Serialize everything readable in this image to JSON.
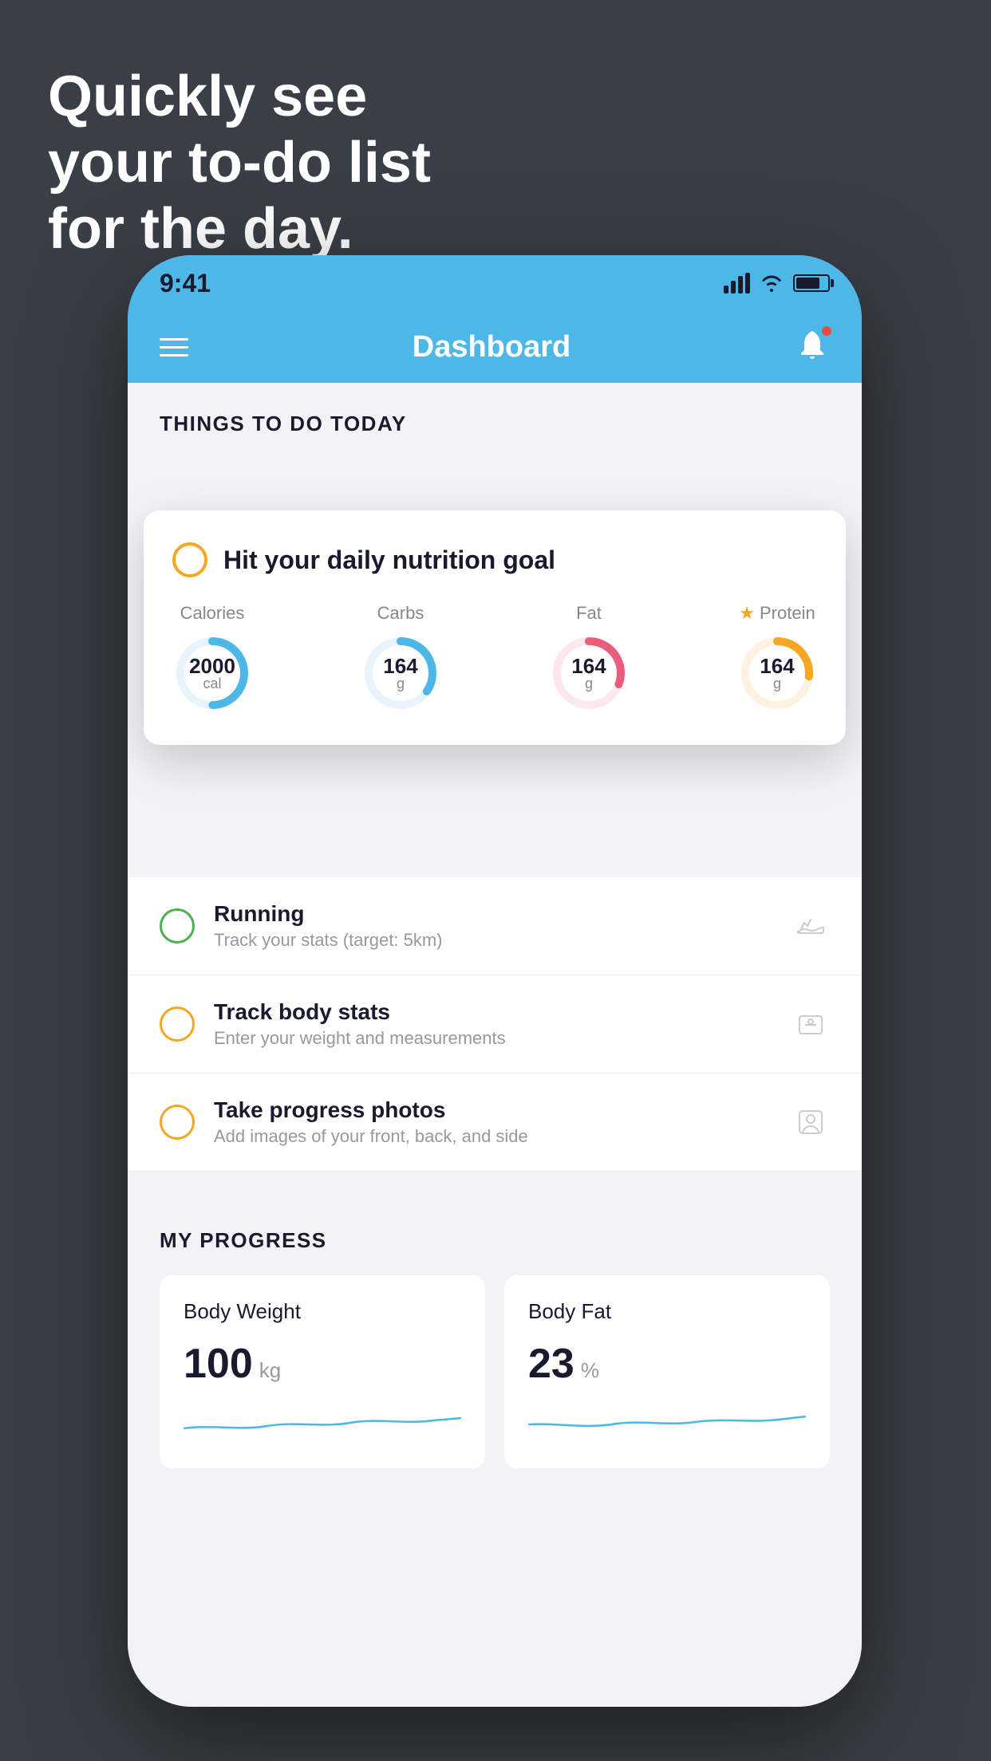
{
  "background": {
    "color": "#3a3f47"
  },
  "headline": {
    "line1": "Quickly see",
    "line2": "your to-do list",
    "line3": "for the day."
  },
  "phone": {
    "status_bar": {
      "time": "9:41"
    },
    "nav_bar": {
      "title": "Dashboard"
    },
    "section_header": {
      "title": "THINGS TO DO TODAY"
    },
    "nutrition_card": {
      "title": "Hit your daily nutrition goal",
      "rings": [
        {
          "label": "Calories",
          "value": "2000",
          "unit": "cal",
          "color": "#4db8e8",
          "star": false
        },
        {
          "label": "Carbs",
          "value": "164",
          "unit": "g",
          "color": "#4db8e8",
          "star": false
        },
        {
          "label": "Fat",
          "value": "164",
          "unit": "g",
          "color": "#e85d7a",
          "star": false
        },
        {
          "label": "Protein",
          "value": "164",
          "unit": "g",
          "color": "#f5a623",
          "star": true
        }
      ]
    },
    "todo_items": [
      {
        "title": "Running",
        "subtitle": "Track your stats (target: 5km)",
        "icon": "shoe",
        "circle_color": "green"
      },
      {
        "title": "Track body stats",
        "subtitle": "Enter your weight and measurements",
        "icon": "scale",
        "circle_color": "yellow"
      },
      {
        "title": "Take progress photos",
        "subtitle": "Add images of your front, back, and side",
        "icon": "person",
        "circle_color": "yellow"
      }
    ],
    "progress": {
      "title": "MY PROGRESS",
      "cards": [
        {
          "title": "Body Weight",
          "value": "100",
          "unit": "kg"
        },
        {
          "title": "Body Fat",
          "value": "23",
          "unit": "%"
        }
      ]
    }
  }
}
